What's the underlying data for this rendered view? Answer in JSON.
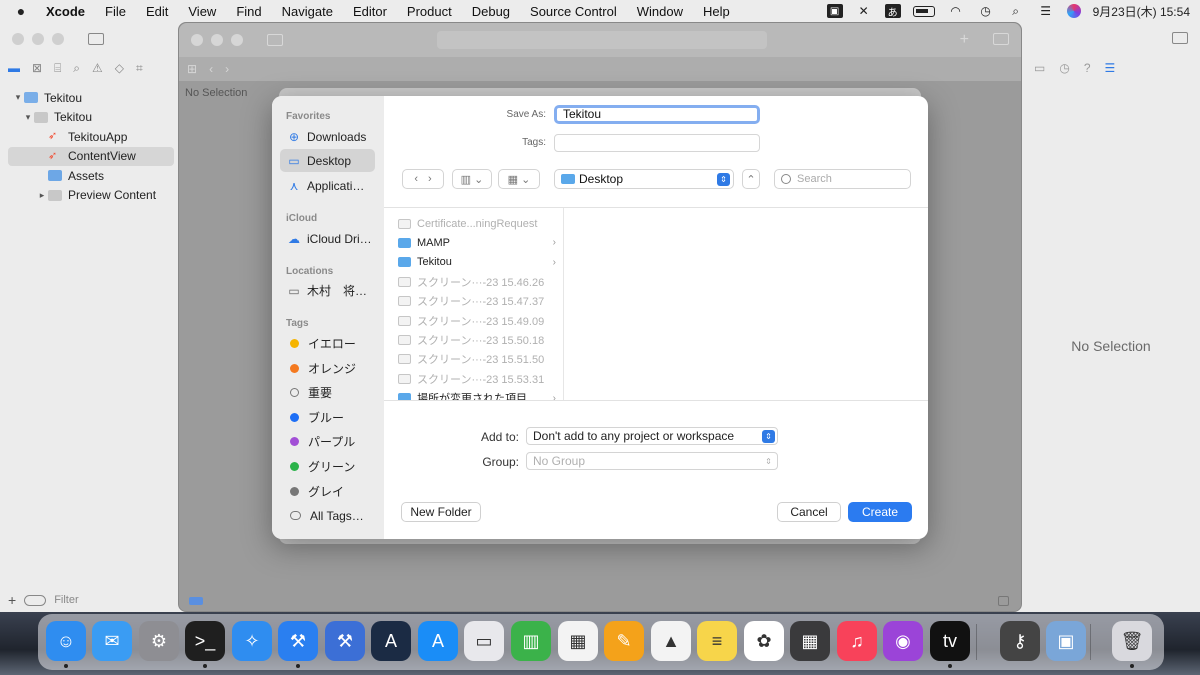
{
  "menubar": {
    "apple_icon": "apple-logo-icon",
    "items": [
      "Xcode",
      "File",
      "Edit",
      "View",
      "Find",
      "Navigate",
      "Editor",
      "Product",
      "Debug",
      "Source Control",
      "Window",
      "Help"
    ],
    "input_method": "あ",
    "clock": "9月23日(木) 15:54"
  },
  "navigator": {
    "rows": [
      {
        "label": "Tekitou",
        "disclosure": "▾",
        "icon": "project-icon"
      },
      {
        "label": "Tekitou",
        "disclosure": "▾",
        "icon": "folder-icon"
      },
      {
        "label": "TekitouApp",
        "disclosure": "",
        "icon": "swift-file-icon"
      },
      {
        "label": "ContentView",
        "disclosure": "",
        "icon": "swift-file-icon"
      },
      {
        "label": "Assets",
        "disclosure": "",
        "icon": "asset-catalog-icon"
      },
      {
        "label": "Preview Content",
        "disclosure": "▸",
        "icon": "folder-icon"
      }
    ],
    "filter_placeholder": "Filter"
  },
  "editor": {
    "no_selection_small": "No Selection"
  },
  "inspector": {
    "no_selection": "No Selection"
  },
  "dialog": {
    "sidebar": {
      "favorites_header": "Favorites",
      "favorites": [
        {
          "label": "Downloads",
          "icon": "download-icon"
        },
        {
          "label": "Desktop",
          "icon": "desktop-icon"
        },
        {
          "label": "Applicati…",
          "icon": "applications-icon"
        }
      ],
      "icloud_header": "iCloud",
      "icloud": [
        {
          "label": "iCloud Dri…",
          "icon": "cloud-icon"
        }
      ],
      "locations_header": "Locations",
      "locations": [
        {
          "label": "木村　将…",
          "icon": "laptop-icon"
        }
      ],
      "tags_header": "Tags",
      "tags": [
        {
          "label": "イエロー",
          "color": "#f5b400"
        },
        {
          "label": "オレンジ",
          "color": "#f4791f"
        },
        {
          "label": "重要",
          "color": "hollow"
        },
        {
          "label": "ブルー",
          "color": "#1d6ef5"
        },
        {
          "label": "パープル",
          "color": "#a24fd6"
        },
        {
          "label": "グリーン",
          "color": "#2bb34a"
        },
        {
          "label": "グレイ",
          "color": "#777777"
        },
        {
          "label": "All Tags…",
          "color": "all"
        }
      ]
    },
    "save_as_label": "Save As:",
    "save_as_value": "Tekitou",
    "tags_label": "Tags:",
    "location": "Desktop",
    "search_placeholder": "Search",
    "files": [
      {
        "name": "Certificate...ningRequest",
        "type": "file",
        "dim": true,
        "chevron": ""
      },
      {
        "name": "MAMP",
        "type": "folder",
        "dim": false,
        "chevron": "›"
      },
      {
        "name": "Tekitou",
        "type": "folder",
        "dim": false,
        "chevron": "›"
      },
      {
        "name": "スクリーン···-23 15.46.26",
        "type": "file",
        "dim": true,
        "chevron": ""
      },
      {
        "name": "スクリーン···-23 15.47.37",
        "type": "file",
        "dim": true,
        "chevron": ""
      },
      {
        "name": "スクリーン···-23 15.49.09",
        "type": "file",
        "dim": true,
        "chevron": ""
      },
      {
        "name": "スクリーン···-23 15.50.18",
        "type": "file",
        "dim": true,
        "chevron": ""
      },
      {
        "name": "スクリーン···-23 15.51.50",
        "type": "file",
        "dim": true,
        "chevron": ""
      },
      {
        "name": "スクリーン···-23 15.53.31",
        "type": "file",
        "dim": true,
        "chevron": ""
      },
      {
        "name": "場所が変更された項目",
        "type": "folder",
        "dim": false,
        "chevron": "›"
      }
    ],
    "add_to_label": "Add to:",
    "add_to_value": "Don't add to any project or workspace",
    "group_label": "Group:",
    "group_value": "No Group",
    "new_folder": "New Folder",
    "cancel": "Cancel",
    "create": "Create"
  },
  "dock": {
    "apps": [
      {
        "name": "finder-icon",
        "color": "#2f8df0",
        "glyph": "☺"
      },
      {
        "name": "mail-icon",
        "color": "#3a9cf3",
        "glyph": "✉"
      },
      {
        "name": "system-preferences-icon",
        "color": "#8e8e93",
        "glyph": "⚙"
      },
      {
        "name": "terminal-icon",
        "color": "#1f1f1f",
        "glyph": ">_"
      },
      {
        "name": "safari-icon",
        "color": "#2f8df0",
        "glyph": "✧"
      },
      {
        "name": "xcode-icon",
        "color": "#2a7ff0",
        "glyph": "⚒"
      },
      {
        "name": "xcode-beta-icon",
        "color": "#3c6fd6",
        "glyph": "⚒"
      },
      {
        "name": "instruments-icon",
        "color": "#1b2b44",
        "glyph": "A"
      },
      {
        "name": "app-store-icon",
        "color": "#1a8df7",
        "glyph": "A"
      },
      {
        "name": "simulator-icon",
        "color": "#e8e8ec",
        "glyph": "▭"
      },
      {
        "name": "numbers-icon",
        "color": "#3bb24a",
        "glyph": "▥"
      },
      {
        "name": "pages-icon",
        "color": "#f3f3f3",
        "glyph": "▦"
      },
      {
        "name": "pages-pen-icon",
        "color": "#f4a21a",
        "glyph": "✎"
      },
      {
        "name": "keynote-icon",
        "color": "#f3f3f3",
        "glyph": "▲"
      },
      {
        "name": "notes-icon",
        "color": "#f7d54a",
        "glyph": "≡"
      },
      {
        "name": "photos-icon",
        "color": "#ffffff",
        "glyph": "✿"
      },
      {
        "name": "calculator-icon",
        "color": "#3a3a3c",
        "glyph": "▦"
      },
      {
        "name": "music-icon",
        "color": "#f8425a",
        "glyph": "♫"
      },
      {
        "name": "podcasts-icon",
        "color": "#9b44d8",
        "glyph": "◉"
      },
      {
        "name": "tv-icon",
        "color": "#111111",
        "glyph": "tv"
      },
      {
        "name": "keychain-icon",
        "color": "#444444",
        "glyph": "⚷"
      },
      {
        "name": "preview-icon",
        "color": "#7aa6d8",
        "glyph": "▣"
      },
      {
        "name": "trash-icon",
        "color": "#d9d9de",
        "glyph": "🗑"
      }
    ]
  }
}
